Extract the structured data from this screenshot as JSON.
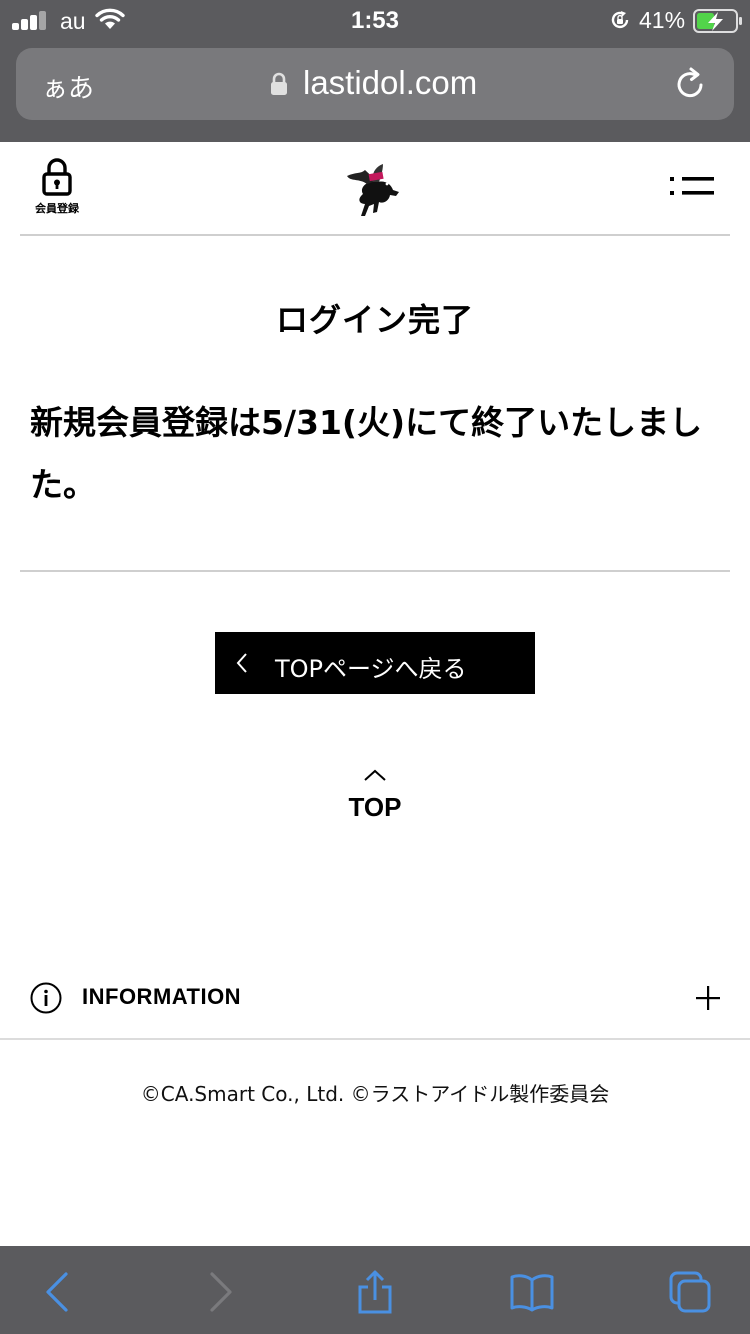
{
  "status_bar": {
    "carrier": "au",
    "time": "1:53",
    "battery_percent": "41%"
  },
  "browser": {
    "text_size_button": "ぁあ",
    "url": "lastidol.com"
  },
  "header": {
    "member_label": "会員登録"
  },
  "main": {
    "title": "ログイン完了",
    "notice": "新規会員登録は5/31(火)にて終了いたしました。",
    "back_button_label": "TOPページへ戻る",
    "top_label": "TOP"
  },
  "footer": {
    "information_label": "INFORMATION",
    "copyright": "©CA.Smart Co., Ltd. ©ラストアイドル製作委員会"
  },
  "colors": {
    "browser_chrome": "#5b5b5e",
    "address_field": "#79797c",
    "toolbar_active_icon": "#4a90e2",
    "toolbar_disabled_icon": "#7a7a7d",
    "button_bg": "#000000",
    "battery_charge": "#52d44a"
  }
}
